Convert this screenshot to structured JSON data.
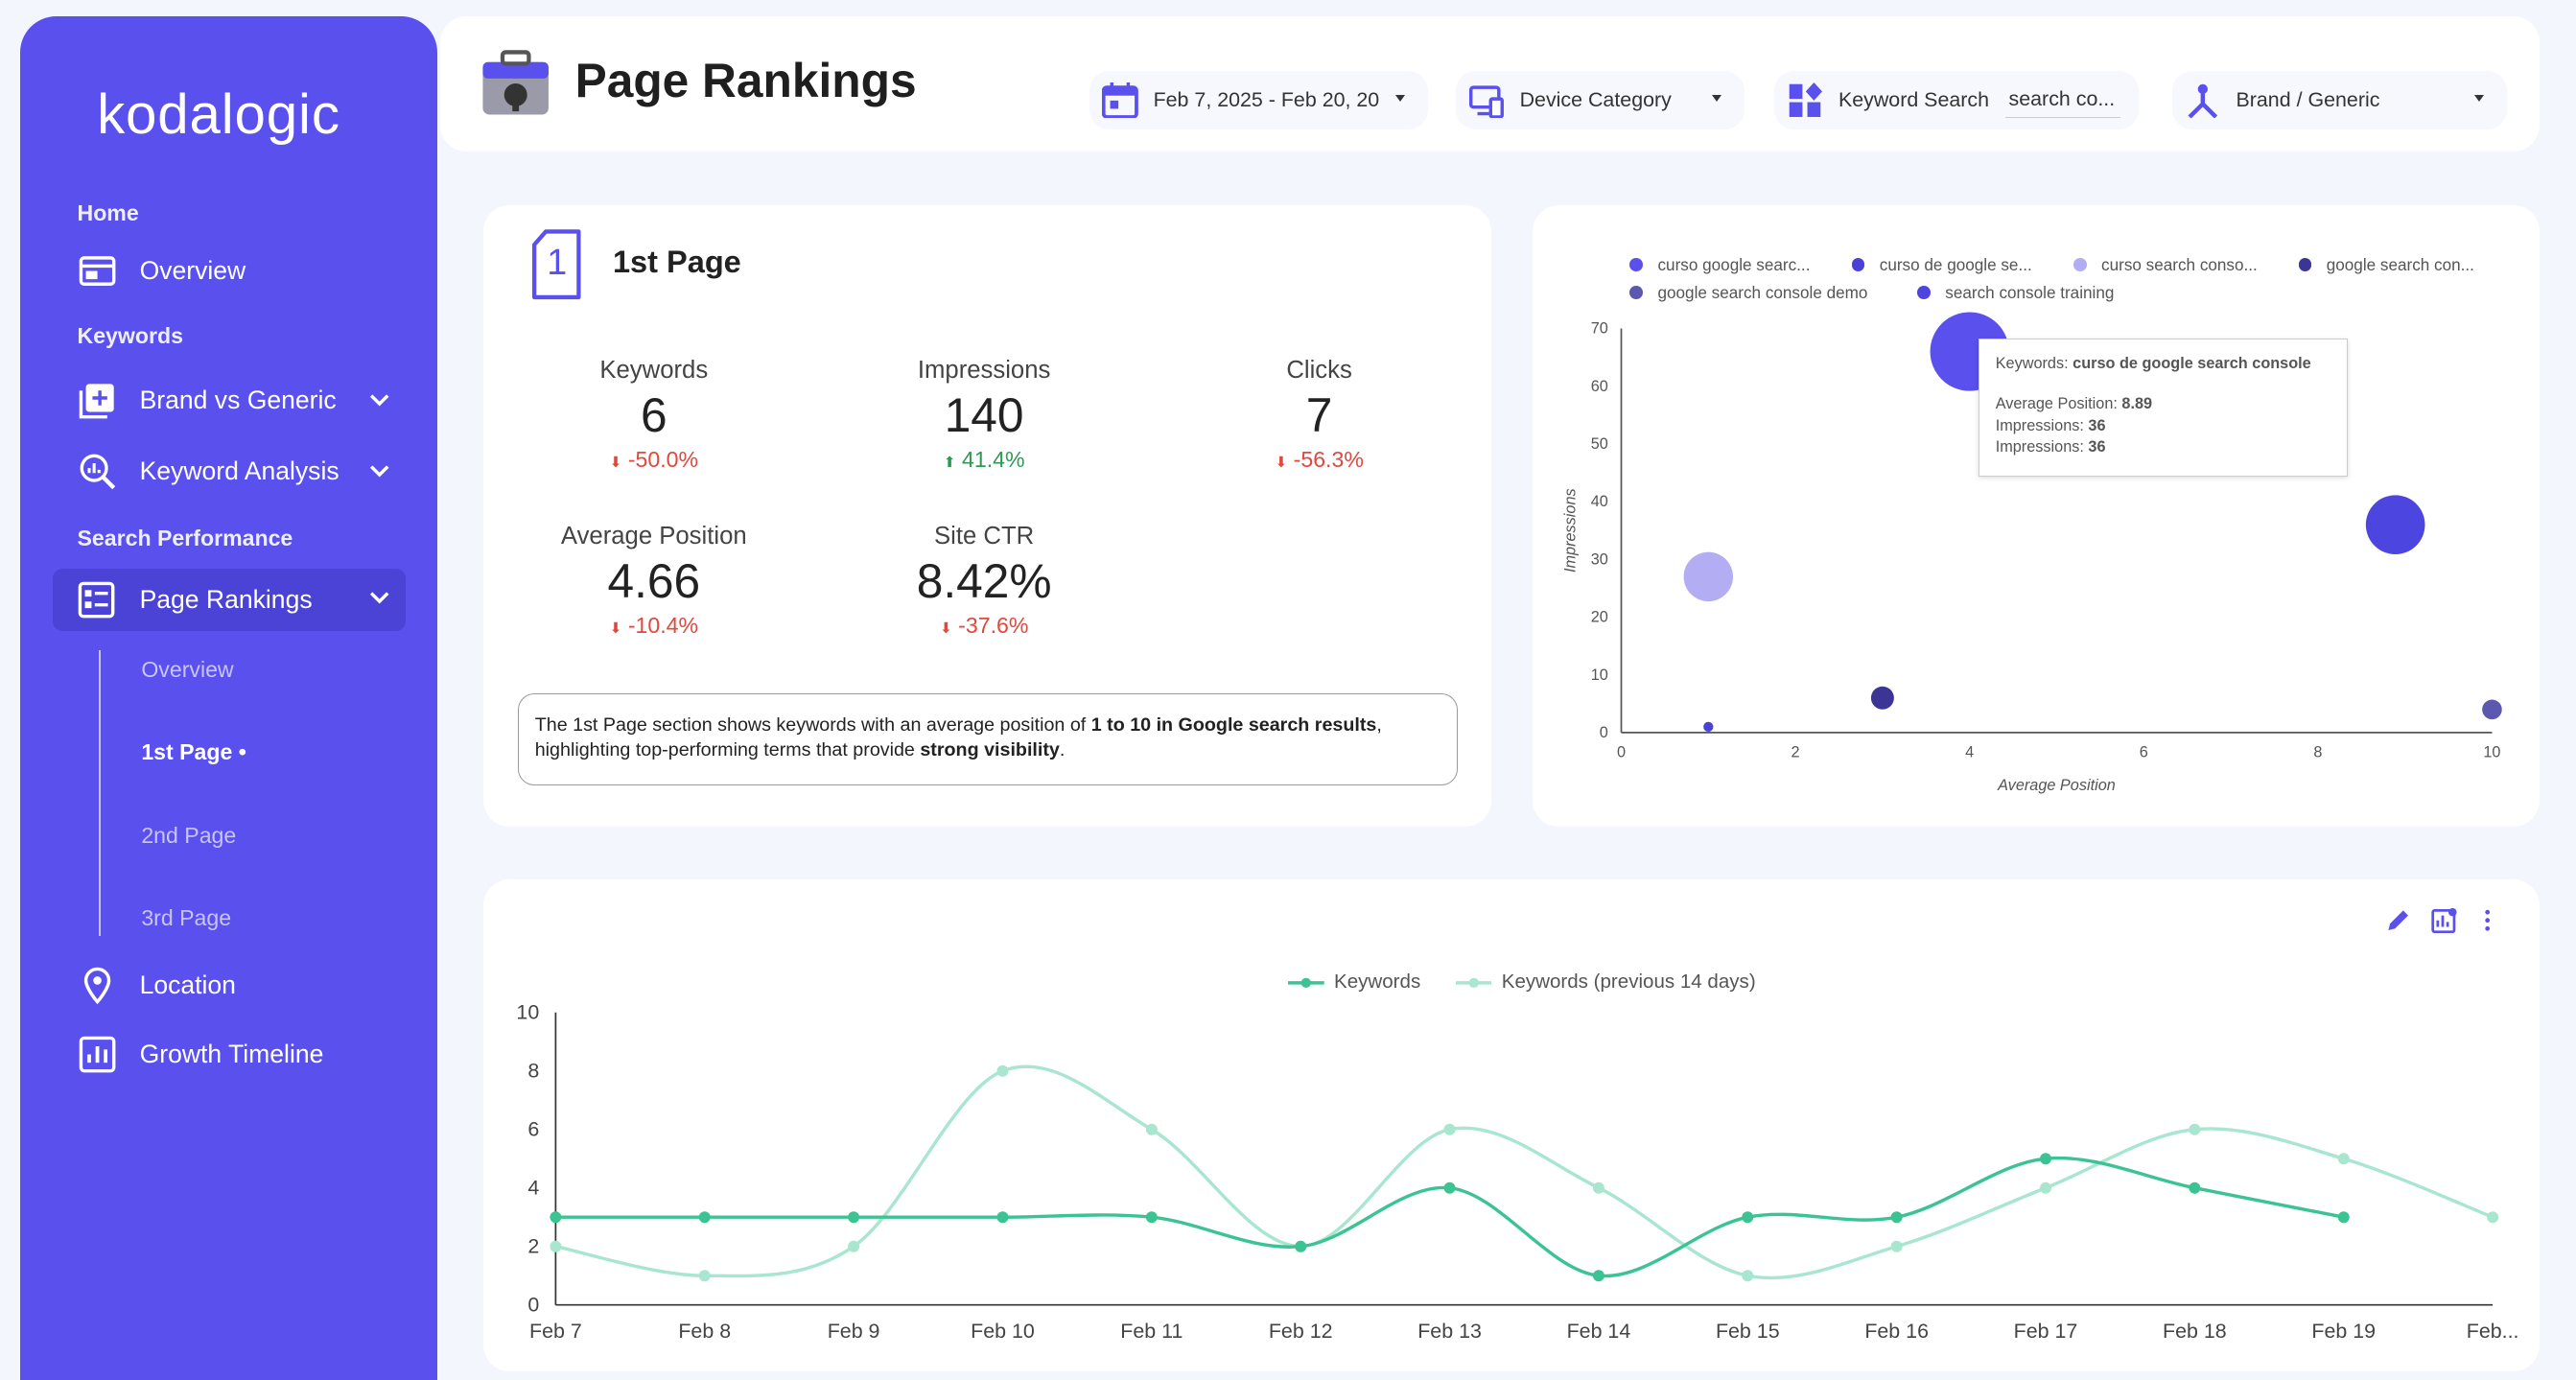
{
  "brand": "kodalogic",
  "colors": {
    "accent": "#5a50ee",
    "green": "#3cc393",
    "light_green": "#a8e6d0",
    "neg": "#e0483e",
    "pos": "#2e9a55"
  },
  "sidebar": {
    "sections": [
      "Home",
      "Keywords",
      "Search Performance"
    ],
    "items": [
      {
        "label": "Overview",
        "icon": "dashboard-icon"
      },
      {
        "label": "Brand vs Generic",
        "icon": "add-box-icon"
      },
      {
        "label": "Keyword Analysis",
        "icon": "search-analytics-icon"
      },
      {
        "label": "Page Rankings",
        "icon": "list-icon"
      },
      {
        "label": "Location",
        "icon": "location-pin-icon"
      },
      {
        "label": "Growth Timeline",
        "icon": "bar-chart-icon"
      }
    ],
    "subitems": [
      "Overview",
      "1st Page •",
      "2nd Page",
      "3rd Page"
    ]
  },
  "header": {
    "title": "Page Rankings",
    "date_range": "Feb 7, 2025 - Feb 20, 20",
    "device": "Device Category",
    "keyword_label": "Keyword Search",
    "keyword_value": "search co...",
    "brand_filter": "Brand / Generic"
  },
  "summary": {
    "badge": "1",
    "title": "1st Page",
    "kpis": [
      {
        "label": "Keywords",
        "value": "6",
        "delta": "-50.0%",
        "dir": "down"
      },
      {
        "label": "Impressions",
        "value": "140",
        "delta": "41.4%",
        "dir": "up"
      },
      {
        "label": "Clicks",
        "value": "7",
        "delta": "-56.3%",
        "dir": "down"
      },
      {
        "label": "Average Position",
        "value": "4.66",
        "delta": "-10.4%",
        "dir": "down"
      },
      {
        "label": "Site CTR",
        "value": "8.42%",
        "delta": "-37.6%",
        "dir": "down"
      }
    ],
    "note": {
      "p1": "The 1st Page section shows keywords with an average position of ",
      "b1": "1 to 10 in Google search results",
      "p2": ", highlighting top-performing terms that provide ",
      "b2": "strong visibility",
      "p3": "."
    }
  },
  "chart_data": [
    {
      "type": "scatter",
      "xlabel": "Average Position",
      "ylabel": "Impressions",
      "xlim": [
        0,
        10
      ],
      "ylim": [
        0,
        70
      ],
      "xticks": [
        "0",
        "2",
        "4",
        "6",
        "8",
        "10"
      ],
      "yticks": [
        "0",
        "10",
        "20",
        "30",
        "40",
        "50",
        "60",
        "70"
      ],
      "legend": [
        {
          "name": "curso google searc...",
          "color": "#5a50ee"
        },
        {
          "name": "curso de google se...",
          "color": "#4a42d8"
        },
        {
          "name": "curso search conso...",
          "color": "#b3aef3"
        },
        {
          "name": "google search con...",
          "color": "#3b3596"
        },
        {
          "name": "google search console demo",
          "color": "#5c58b0"
        },
        {
          "name": "search console training",
          "color": "#4d45e0"
        }
      ],
      "points": [
        {
          "x": 4,
          "y": 66,
          "r": 24,
          "color": "#5a50ee"
        },
        {
          "x": 8.89,
          "y": 36,
          "r": 18,
          "color": "#4d45e0"
        },
        {
          "x": 1,
          "y": 27,
          "r": 15,
          "color": "#b3aef3"
        },
        {
          "x": 3,
          "y": 6,
          "r": 7,
          "color": "#3b3596"
        },
        {
          "x": 10,
          "y": 4,
          "r": 6,
          "color": "#5c58b0"
        },
        {
          "x": 1,
          "y": 1,
          "r": 3,
          "color": "#4a42d8"
        }
      ],
      "tooltip": {
        "k_label": "Keywords: ",
        "k_value": "curso de google search console",
        "l1": "Average Position: ",
        "v1": "8.89",
        "l2": "Impressions: ",
        "v2": "36",
        "l3": "Impressions: ",
        "v3": "36"
      }
    },
    {
      "type": "line",
      "ylim": [
        0,
        10
      ],
      "yticks": [
        "0",
        "2",
        "4",
        "6",
        "8",
        "10"
      ],
      "categories": [
        "Feb 7",
        "Feb 8",
        "Feb 9",
        "Feb 10",
        "Feb 11",
        "Feb 12",
        "Feb 13",
        "Feb 14",
        "Feb 15",
        "Feb 16",
        "Feb 17",
        "Feb 18",
        "Feb 19",
        "Feb..."
      ],
      "series": [
        {
          "name": "Keywords",
          "color": "#3cc393",
          "values": [
            3,
            3,
            3,
            3,
            3,
            2,
            4,
            1,
            3,
            3,
            5,
            4,
            3,
            null
          ]
        },
        {
          "name": "Keywords (previous 14 days)",
          "color": "#a8e6d0",
          "values": [
            2,
            1,
            2,
            8,
            6,
            2,
            6,
            4,
            1,
            2,
            4,
            6,
            5,
            3
          ]
        }
      ],
      "legend": "top",
      "grid": false
    }
  ]
}
